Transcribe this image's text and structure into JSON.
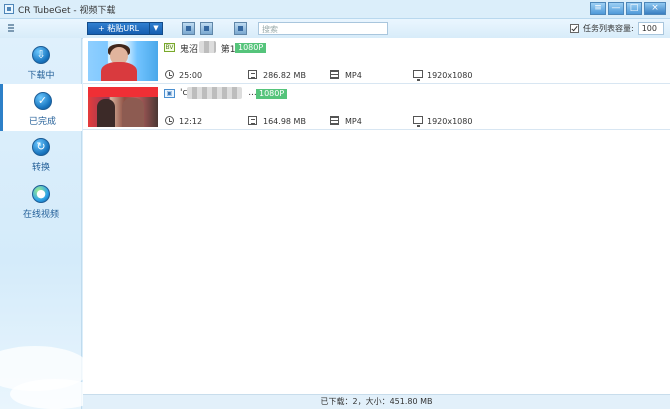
{
  "window": {
    "title": "CR TubeGet - 视频下载"
  },
  "toolbar": {
    "paste_url": "+ 粘贴URL",
    "search_placeholder": "搜索",
    "queue_capacity_label": "任务列表容量:",
    "queue_capacity_value": "100"
  },
  "sidebar": {
    "items": [
      {
        "label": "下载中",
        "icon": "download-icon"
      },
      {
        "label": "已完成",
        "icon": "check-icon"
      },
      {
        "label": "转换",
        "icon": "convert-icon"
      },
      {
        "label": "在线视频",
        "icon": "globe-icon"
      }
    ]
  },
  "videos": [
    {
      "title_prefix": "鬼沼",
      "title_suffix": "第1集",
      "quality": "1080P",
      "duration": "25:00",
      "size": "286.82 MB",
      "format": "MP4",
      "resolution": "1920x1080"
    },
    {
      "title_prefix": "'c",
      "title_suffix": "...",
      "quality": "1080P",
      "duration": "12:12",
      "size": "164.98 MB",
      "format": "MP4",
      "resolution": "1920x1080"
    }
  ],
  "status": {
    "summary": "已下载：2，大小：451.80 MB"
  }
}
